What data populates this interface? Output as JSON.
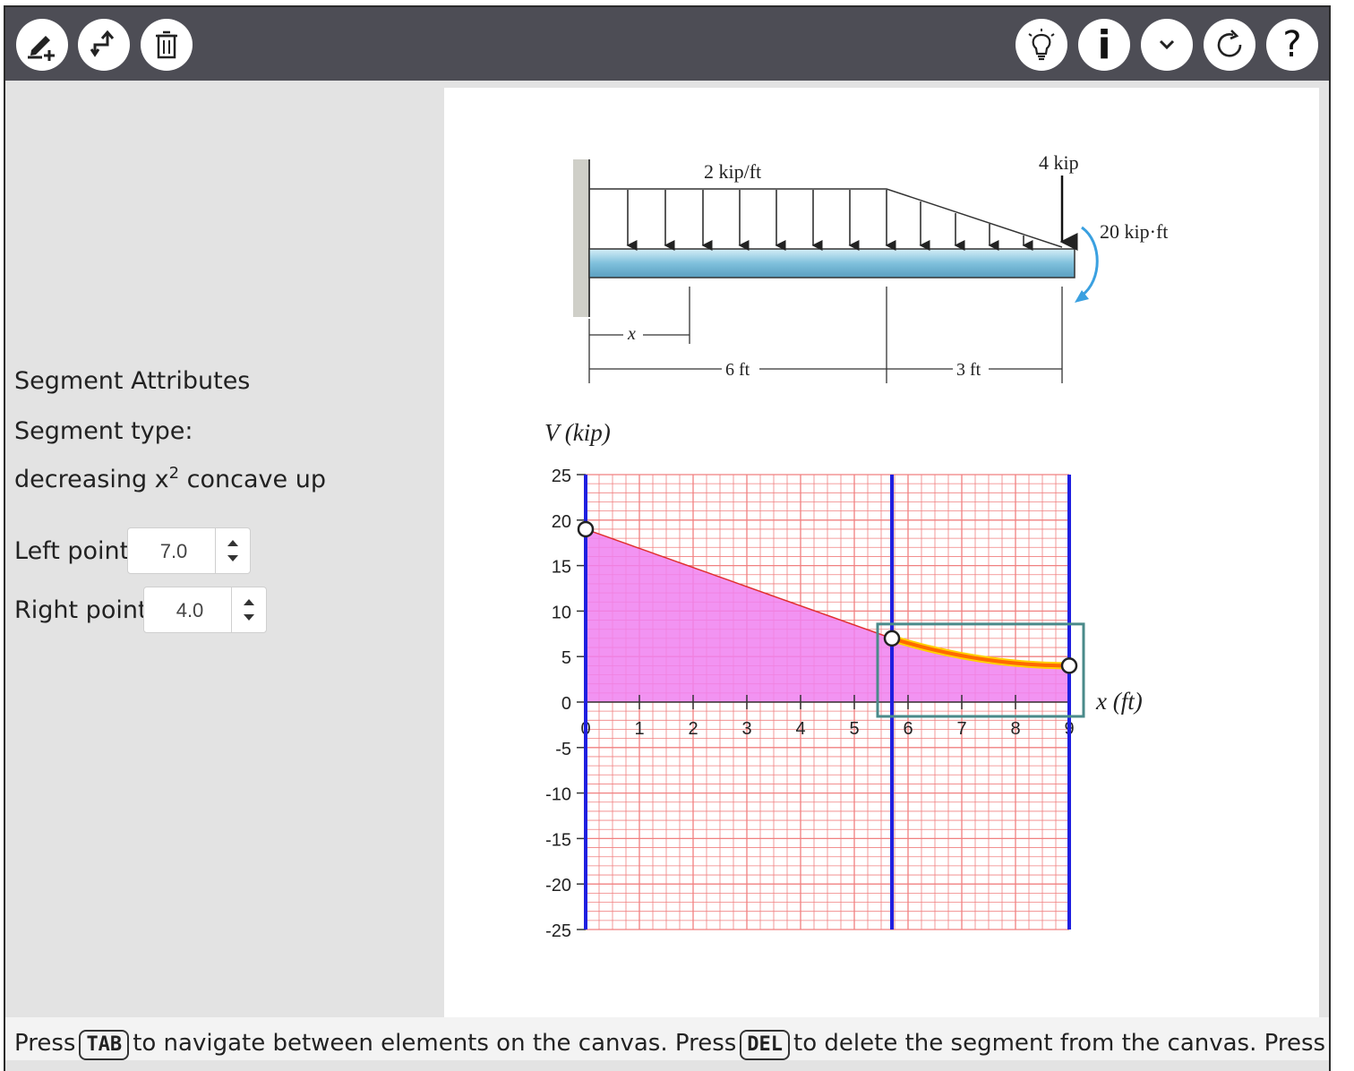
{
  "toolbar": {
    "left_buttons": [
      "add-segment",
      "connect-segments",
      "delete-segment"
    ],
    "right_buttons": [
      "hint",
      "info",
      "expand",
      "reset",
      "help"
    ],
    "info_glyph": "i",
    "help_glyph": "?"
  },
  "segment_panel": {
    "title": "Segment Attributes",
    "type_label": "Segment type:",
    "type_value_prefix": "decreasing x",
    "type_value_superscript": "2",
    "type_value_suffix": " concave up",
    "left_label": "Left point",
    "left_value": "7.0",
    "right_label": "Right point",
    "right_value": "4.0"
  },
  "problem_figure": {
    "distributed_load": "2 kip/ft",
    "point_load": "4 kip",
    "moment": "20 kip·ft",
    "x_label": "x",
    "dim_1": "6 ft",
    "dim_2": "3 ft"
  },
  "chart_data": {
    "type": "line",
    "ylabel": "V (kip)",
    "xlabel": "x (ft)",
    "xlim": [
      0,
      9
    ],
    "ylim": [
      -25,
      25
    ],
    "xticks": [
      0,
      1,
      2,
      3,
      4,
      5,
      6,
      7,
      8,
      9
    ],
    "yticks": [
      25,
      20,
      15,
      10,
      5,
      0,
      -5,
      -10,
      -15,
      -20,
      -25
    ],
    "boundaries": [
      0,
      5.7,
      9
    ],
    "segments": [
      {
        "type": "linear",
        "x": [
          0,
          5.7
        ],
        "y": [
          19,
          7
        ]
      },
      {
        "type": "decreasing x^2 concave up",
        "x": [
          5.7,
          9
        ],
        "y": [
          7,
          4
        ],
        "selected": true
      }
    ],
    "handles": [
      [
        0,
        19
      ],
      [
        5.7,
        7
      ],
      [
        9,
        4
      ]
    ],
    "colors": {
      "fill": "#f080f0",
      "grid": "#f08080",
      "boundary": "#1f1fe0",
      "selected_curve": "#ff6a00",
      "selection_box": "#4a8a8a",
      "segment_line": "#e03030"
    }
  },
  "footer": {
    "t1": "Press",
    "k1": "TAB",
    "t2": "to navigate between elements on the canvas. Press",
    "k2": "DEL",
    "t3": "to delete the segment from the canvas. Press"
  }
}
